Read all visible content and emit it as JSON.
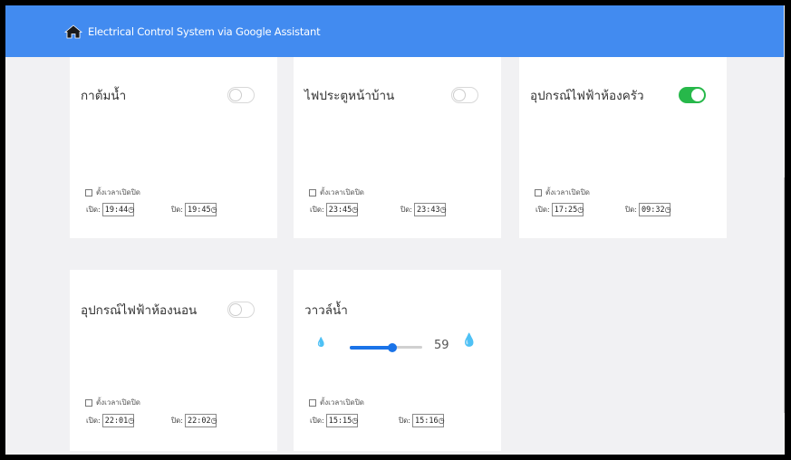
{
  "header": {
    "title": "Electrical Control System via Google Assistant",
    "icon": "home-icon",
    "color": "#428bf0"
  },
  "devices": [
    {
      "name": "กาต้มน้ำ",
      "on": false,
      "timer_label": "ตั้งเวลาเปิดปิด",
      "timer_enabled": false,
      "open_label": "เปิด:",
      "open_time": "19:44",
      "close_label": "ปิด:",
      "close_time": "19:45"
    },
    {
      "name": "ไฟประตูหน้าบ้าน",
      "on": false,
      "timer_label": "ตั้งเวลาเปิดปิด",
      "timer_enabled": false,
      "open_label": "เปิด:",
      "open_time": "23:45",
      "close_label": "ปิด:",
      "close_time": "23:43"
    },
    {
      "name": "อุปกรณ์ไฟฟ้าห้องครัว",
      "on": true,
      "timer_label": "ตั้งเวลาเปิดปิด",
      "timer_enabled": false,
      "open_label": "เปิด:",
      "open_time": "17:25",
      "close_label": "ปิด:",
      "close_time": "09:32"
    },
    {
      "name": "อุปกรณ์ไฟฟ้าห้องนอน",
      "on": false,
      "timer_label": "ตั้งเวลาเปิดปิด",
      "timer_enabled": false,
      "open_label": "เปิด:",
      "open_time": "22:01",
      "close_label": "ปิด:",
      "close_time": "22:02"
    },
    {
      "name": "วาวล์น้ำ",
      "slider_value": 59,
      "slider_fraction": 0.59,
      "timer_label": "ตั้งเวลาเปิดปิด",
      "timer_enabled": false,
      "open_label": "เปิด:",
      "open_time": "15:15",
      "close_label": "ปิด:",
      "close_time": "15:16"
    }
  ],
  "colors": {
    "toggle_on": "#27b84a",
    "slider": "#1a73e8"
  },
  "icons": {
    "clock": "clock-icon",
    "drop_low": "water-drop-low-icon",
    "drop_high": "water-drop-high-icon"
  }
}
